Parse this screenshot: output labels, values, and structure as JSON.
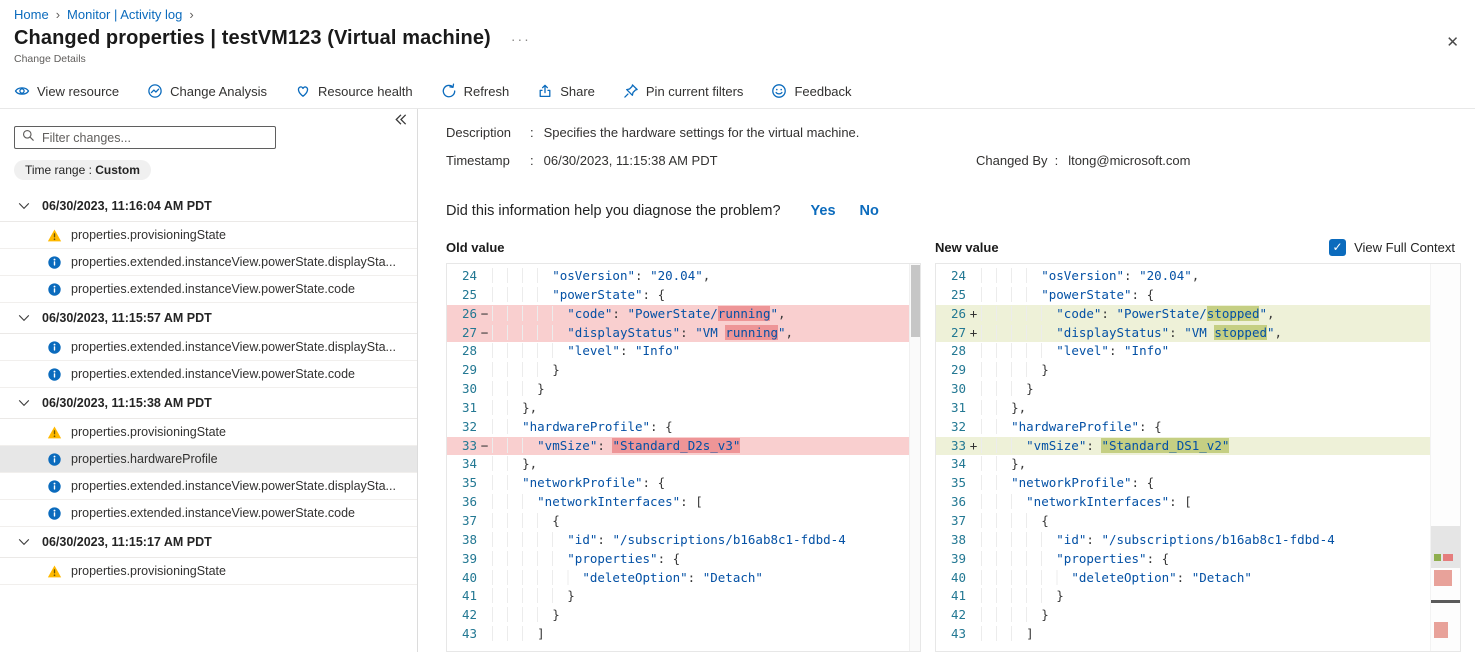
{
  "breadcrumb": {
    "items": [
      "Home",
      "Monitor | Activity log"
    ]
  },
  "header": {
    "title": "Changed properties | testVM123 (Virtual machine)",
    "menu_ellipsis": "···",
    "subtitle": "Change Details",
    "close_glyph": "✕"
  },
  "toolbar": {
    "items": [
      {
        "icon": "view-resource-icon",
        "label": "View resource"
      },
      {
        "icon": "change-analysis-icon",
        "label": "Change Analysis"
      },
      {
        "icon": "resource-health-icon",
        "label": "Resource health"
      },
      {
        "icon": "refresh-icon",
        "label": "Refresh"
      },
      {
        "icon": "share-icon",
        "label": "Share"
      },
      {
        "icon": "pin-icon",
        "label": "Pin current filters"
      },
      {
        "icon": "feedback-icon",
        "label": "Feedback"
      }
    ]
  },
  "sidebar": {
    "filter_placeholder": "Filter changes...",
    "time_range": {
      "label": "Time range :",
      "value": "Custom"
    },
    "groups": [
      {
        "date": "06/30/2023, 11:16:04 AM PDT",
        "items": [
          {
            "icon": "warning",
            "label": "properties.provisioningState"
          },
          {
            "icon": "info",
            "label": "properties.extended.instanceView.powerState.displaySta..."
          },
          {
            "icon": "info",
            "label": "properties.extended.instanceView.powerState.code"
          }
        ]
      },
      {
        "date": "06/30/2023, 11:15:57 AM PDT",
        "items": [
          {
            "icon": "info",
            "label": "properties.extended.instanceView.powerState.displaySta..."
          },
          {
            "icon": "info",
            "label": "properties.extended.instanceView.powerState.code"
          }
        ]
      },
      {
        "date": "06/30/2023, 11:15:38 AM PDT",
        "items": [
          {
            "icon": "warning",
            "label": "properties.provisioningState"
          },
          {
            "icon": "info",
            "label": "properties.hardwareProfile",
            "selected": true
          },
          {
            "icon": "info",
            "label": "properties.extended.instanceView.powerState.displaySta..."
          },
          {
            "icon": "info",
            "label": "properties.extended.instanceView.powerState.code"
          }
        ]
      },
      {
        "date": "06/30/2023, 11:15:17 AM PDT",
        "items": [
          {
            "icon": "warning",
            "label": "properties.provisioningState"
          }
        ]
      }
    ]
  },
  "details": {
    "description_label": "Description",
    "description_value": "Specifies the hardware settings for the virtual machine.",
    "timestamp_label": "Timestamp",
    "timestamp_value": "06/30/2023, 11:15:38 AM PDT",
    "changed_by_label": "Changed By",
    "changed_by_value": "ltong@microsoft.com",
    "question": "Did this information help you diagnose the problem?",
    "yes_label": "Yes",
    "no_label": "No"
  },
  "diff": {
    "old_label": "Old value",
    "new_label": "New value",
    "view_full_context_label": "View Full Context",
    "old_lines": [
      {
        "n": 24,
        "s": "",
        "c": "",
        "seg": [
          [
            "i",
            "        "
          ],
          [
            "s",
            "\"osVersion\""
          ],
          [
            "p",
            ": "
          ],
          [
            "s",
            "\"20.04\""
          ],
          [
            "p",
            ","
          ]
        ]
      },
      {
        "n": 25,
        "s": "",
        "c": "",
        "seg": [
          [
            "i",
            "        "
          ],
          [
            "s",
            "\"powerState\""
          ],
          [
            "p",
            ": {"
          ]
        ]
      },
      {
        "n": 26,
        "s": "−",
        "c": "del",
        "seg": [
          [
            "i",
            "          "
          ],
          [
            "s",
            "\"code\""
          ],
          [
            "p",
            ": "
          ],
          [
            "s",
            "\"PowerState/"
          ],
          [
            "h",
            "running"
          ],
          [
            "s",
            "\""
          ],
          [
            "p",
            ","
          ]
        ]
      },
      {
        "n": 27,
        "s": "−",
        "c": "del",
        "seg": [
          [
            "i",
            "          "
          ],
          [
            "s",
            "\"displayStatus\""
          ],
          [
            "p",
            ": "
          ],
          [
            "s",
            "\"VM "
          ],
          [
            "h",
            "running"
          ],
          [
            "s",
            "\""
          ],
          [
            "p",
            ","
          ]
        ]
      },
      {
        "n": 28,
        "s": "",
        "c": "",
        "seg": [
          [
            "i",
            "          "
          ],
          [
            "s",
            "\"level\""
          ],
          [
            "p",
            ": "
          ],
          [
            "s",
            "\"Info\""
          ]
        ]
      },
      {
        "n": 29,
        "s": "",
        "c": "",
        "seg": [
          [
            "i",
            "        "
          ],
          [
            "p",
            "}"
          ]
        ]
      },
      {
        "n": 30,
        "s": "",
        "c": "",
        "seg": [
          [
            "i",
            "      "
          ],
          [
            "p",
            "}"
          ]
        ]
      },
      {
        "n": 31,
        "s": "",
        "c": "",
        "seg": [
          [
            "i",
            "    "
          ],
          [
            "p",
            "},"
          ]
        ]
      },
      {
        "n": 32,
        "s": "",
        "c": "",
        "seg": [
          [
            "i",
            "    "
          ],
          [
            "s",
            "\"hardwareProfile\""
          ],
          [
            "p",
            ": {"
          ]
        ]
      },
      {
        "n": 33,
        "s": "−",
        "c": "del",
        "seg": [
          [
            "i",
            "      "
          ],
          [
            "s",
            "\"vmSize\""
          ],
          [
            "p",
            ": "
          ],
          [
            "h",
            "\"Standard_D2s_v3\""
          ]
        ]
      },
      {
        "n": 34,
        "s": "",
        "c": "",
        "seg": [
          [
            "i",
            "    "
          ],
          [
            "p",
            "},"
          ]
        ]
      },
      {
        "n": 35,
        "s": "",
        "c": "",
        "seg": [
          [
            "i",
            "    "
          ],
          [
            "s",
            "\"networkProfile\""
          ],
          [
            "p",
            ": {"
          ]
        ]
      },
      {
        "n": 36,
        "s": "",
        "c": "",
        "seg": [
          [
            "i",
            "      "
          ],
          [
            "s",
            "\"networkInterfaces\""
          ],
          [
            "p",
            ": ["
          ]
        ]
      },
      {
        "n": 37,
        "s": "",
        "c": "",
        "seg": [
          [
            "i",
            "        "
          ],
          [
            "p",
            "{"
          ]
        ]
      },
      {
        "n": 38,
        "s": "",
        "c": "",
        "seg": [
          [
            "i",
            "          "
          ],
          [
            "s",
            "\"id\""
          ],
          [
            "p",
            ": "
          ],
          [
            "s",
            "\"/subscriptions/b16ab8c1-fdbd-4"
          ]
        ]
      },
      {
        "n": 39,
        "s": "",
        "c": "",
        "seg": [
          [
            "i",
            "          "
          ],
          [
            "s",
            "\"properties\""
          ],
          [
            "p",
            ": {"
          ]
        ]
      },
      {
        "n": 40,
        "s": "",
        "c": "",
        "seg": [
          [
            "i",
            "            "
          ],
          [
            "s",
            "\"deleteOption\""
          ],
          [
            "p",
            ": "
          ],
          [
            "s",
            "\"Detach\""
          ]
        ]
      },
      {
        "n": 41,
        "s": "",
        "c": "",
        "seg": [
          [
            "i",
            "          "
          ],
          [
            "p",
            "}"
          ]
        ]
      },
      {
        "n": 42,
        "s": "",
        "c": "",
        "seg": [
          [
            "i",
            "        "
          ],
          [
            "p",
            "}"
          ]
        ]
      },
      {
        "n": 43,
        "s": "",
        "c": "",
        "seg": [
          [
            "i",
            "      "
          ],
          [
            "p",
            "]"
          ]
        ]
      }
    ],
    "new_lines": [
      {
        "n": 24,
        "s": "",
        "c": "",
        "seg": [
          [
            "i",
            "        "
          ],
          [
            "s",
            "\"osVersion\""
          ],
          [
            "p",
            ": "
          ],
          [
            "s",
            "\"20.04\""
          ],
          [
            "p",
            ","
          ]
        ]
      },
      {
        "n": 25,
        "s": "",
        "c": "",
        "seg": [
          [
            "i",
            "        "
          ],
          [
            "s",
            "\"powerState\""
          ],
          [
            "p",
            ": {"
          ]
        ]
      },
      {
        "n": 26,
        "s": "+",
        "c": "add",
        "seg": [
          [
            "i",
            "          "
          ],
          [
            "s",
            "\"code\""
          ],
          [
            "p",
            ": "
          ],
          [
            "s",
            "\"PowerState/"
          ],
          [
            "h",
            "stopped"
          ],
          [
            "s",
            "\""
          ],
          [
            "p",
            ","
          ]
        ]
      },
      {
        "n": 27,
        "s": "+",
        "c": "add",
        "seg": [
          [
            "i",
            "          "
          ],
          [
            "s",
            "\"displayStatus\""
          ],
          [
            "p",
            ": "
          ],
          [
            "s",
            "\"VM "
          ],
          [
            "h",
            "stopped"
          ],
          [
            "s",
            "\""
          ],
          [
            "p",
            ","
          ]
        ]
      },
      {
        "n": 28,
        "s": "",
        "c": "",
        "seg": [
          [
            "i",
            "          "
          ],
          [
            "s",
            "\"level\""
          ],
          [
            "p",
            ": "
          ],
          [
            "s",
            "\"Info\""
          ]
        ]
      },
      {
        "n": 29,
        "s": "",
        "c": "",
        "seg": [
          [
            "i",
            "        "
          ],
          [
            "p",
            "}"
          ]
        ]
      },
      {
        "n": 30,
        "s": "",
        "c": "",
        "seg": [
          [
            "i",
            "      "
          ],
          [
            "p",
            "}"
          ]
        ]
      },
      {
        "n": 31,
        "s": "",
        "c": "",
        "seg": [
          [
            "i",
            "    "
          ],
          [
            "p",
            "},"
          ]
        ]
      },
      {
        "n": 32,
        "s": "",
        "c": "",
        "seg": [
          [
            "i",
            "    "
          ],
          [
            "s",
            "\"hardwareProfile\""
          ],
          [
            "p",
            ": {"
          ]
        ]
      },
      {
        "n": 33,
        "s": "+",
        "c": "add",
        "seg": [
          [
            "i",
            "      "
          ],
          [
            "s",
            "\"vmSize\""
          ],
          [
            "p",
            ": "
          ],
          [
            "h",
            "\"Standard_DS1_v2\""
          ]
        ]
      },
      {
        "n": 34,
        "s": "",
        "c": "",
        "seg": [
          [
            "i",
            "    "
          ],
          [
            "p",
            "},"
          ]
        ]
      },
      {
        "n": 35,
        "s": "",
        "c": "",
        "seg": [
          [
            "i",
            "    "
          ],
          [
            "s",
            "\"networkProfile\""
          ],
          [
            "p",
            ": {"
          ]
        ]
      },
      {
        "n": 36,
        "s": "",
        "c": "",
        "seg": [
          [
            "i",
            "      "
          ],
          [
            "s",
            "\"networkInterfaces\""
          ],
          [
            "p",
            ": ["
          ]
        ]
      },
      {
        "n": 37,
        "s": "",
        "c": "",
        "seg": [
          [
            "i",
            "        "
          ],
          [
            "p",
            "{"
          ]
        ]
      },
      {
        "n": 38,
        "s": "",
        "c": "",
        "seg": [
          [
            "i",
            "          "
          ],
          [
            "s",
            "\"id\""
          ],
          [
            "p",
            ": "
          ],
          [
            "s",
            "\"/subscriptions/b16ab8c1-fdbd-4"
          ]
        ]
      },
      {
        "n": 39,
        "s": "",
        "c": "",
        "seg": [
          [
            "i",
            "          "
          ],
          [
            "s",
            "\"properties\""
          ],
          [
            "p",
            ": {"
          ]
        ]
      },
      {
        "n": 40,
        "s": "",
        "c": "",
        "seg": [
          [
            "i",
            "            "
          ],
          [
            "s",
            "\"deleteOption\""
          ],
          [
            "p",
            ": "
          ],
          [
            "s",
            "\"Detach\""
          ]
        ]
      },
      {
        "n": 41,
        "s": "",
        "c": "",
        "seg": [
          [
            "i",
            "          "
          ],
          [
            "p",
            "}"
          ]
        ]
      },
      {
        "n": 42,
        "s": "",
        "c": "",
        "seg": [
          [
            "i",
            "        "
          ],
          [
            "p",
            "}"
          ]
        ]
      },
      {
        "n": 43,
        "s": "",
        "c": "",
        "seg": [
          [
            "i",
            "      "
          ],
          [
            "p",
            "]"
          ]
        ]
      }
    ]
  },
  "colors": {
    "accent": "#0b6bbd",
    "code_string": "#0451a5",
    "line_number": "#237893",
    "del_line_bg": "#f9cfcf",
    "del_char_bg": "#ee9597",
    "add_line_bg": "#eef1d8",
    "add_char_bg": "#c5cf83",
    "warning": "#ffb900"
  }
}
